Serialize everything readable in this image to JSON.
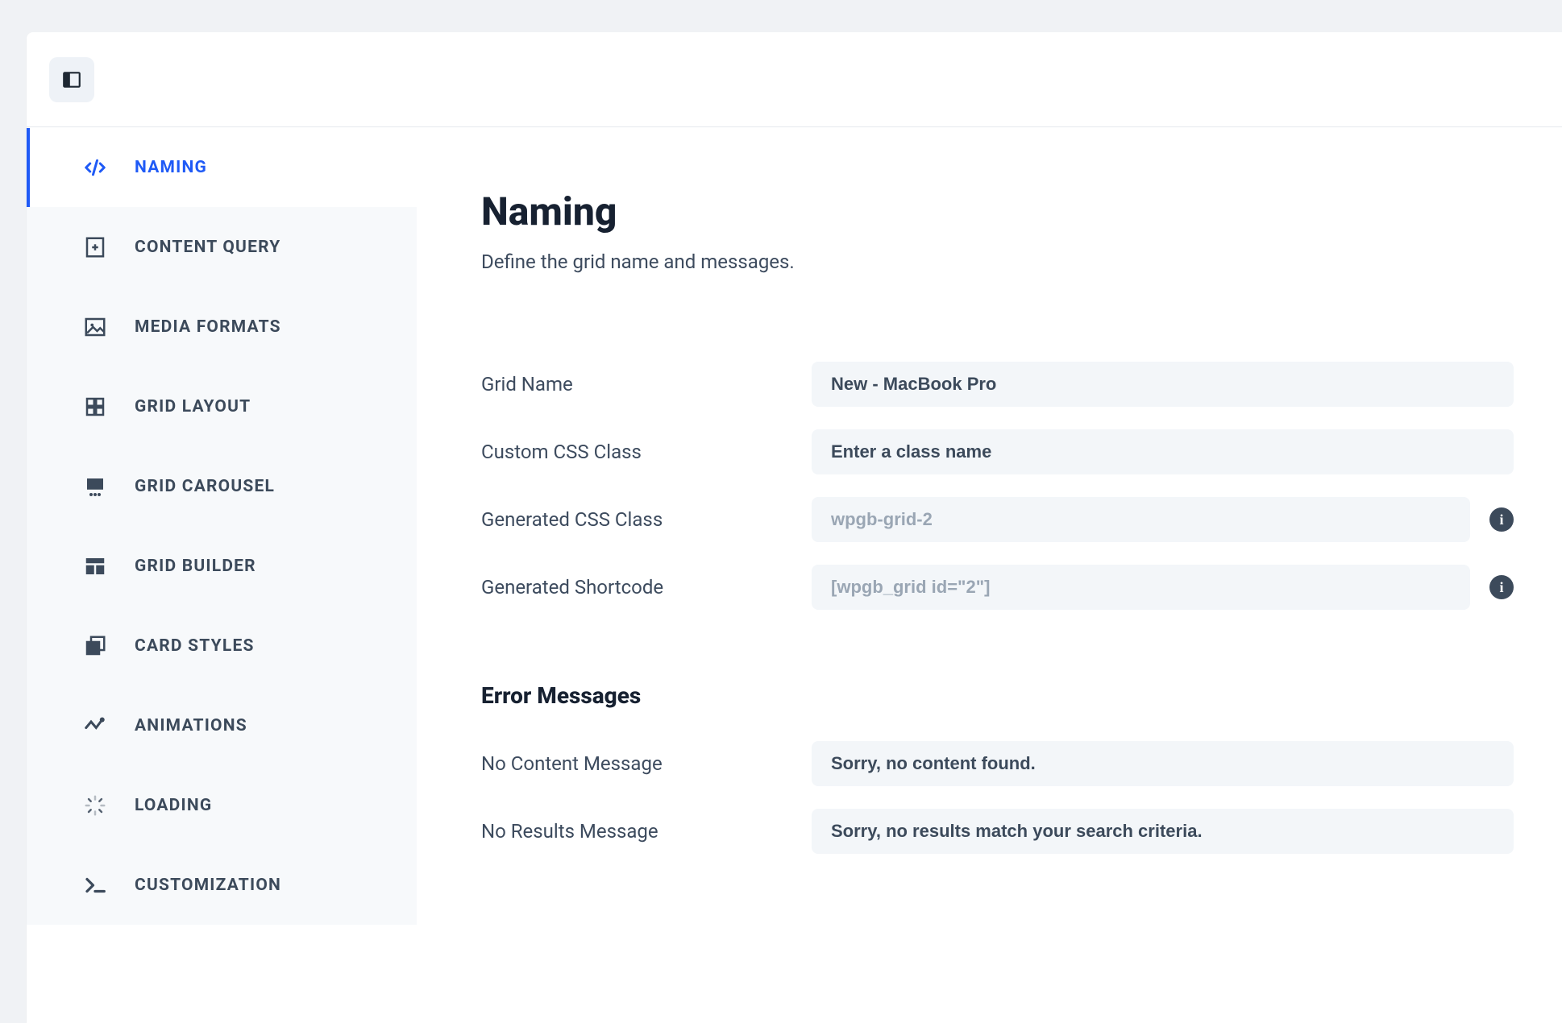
{
  "sidebar": {
    "items": [
      {
        "label": "NAMING",
        "icon": "code-icon",
        "active": true
      },
      {
        "label": "CONTENT QUERY",
        "icon": "add-doc-icon",
        "active": false
      },
      {
        "label": "MEDIA FORMATS",
        "icon": "image-icon",
        "active": false
      },
      {
        "label": "GRID LAYOUT",
        "icon": "grid-icon",
        "active": false
      },
      {
        "label": "GRID CAROUSEL",
        "icon": "carousel-icon",
        "active": false
      },
      {
        "label": "GRID BUILDER",
        "icon": "builder-icon",
        "active": false
      },
      {
        "label": "CARD STYLES",
        "icon": "card-icon",
        "active": false
      },
      {
        "label": "ANIMATIONS",
        "icon": "animation-icon",
        "active": false
      },
      {
        "label": "LOADING",
        "icon": "loading-icon",
        "active": false
      },
      {
        "label": "CUSTOMIZATION",
        "icon": "terminal-icon",
        "active": false
      }
    ]
  },
  "main": {
    "title": "Naming",
    "subtitle": "Define the grid name and messages.",
    "section1": [
      {
        "label": "Grid Name",
        "value": "New - MacBook Pro",
        "placeholder": "",
        "readonly": false,
        "info": false
      },
      {
        "label": "Custom CSS Class",
        "value": "",
        "placeholder": "Enter a class name",
        "readonly": false,
        "info": false
      },
      {
        "label": "Generated CSS Class",
        "value": "wpgb-grid-2",
        "placeholder": "",
        "readonly": true,
        "info": true
      },
      {
        "label": "Generated Shortcode",
        "value": "[wpgb_grid id=\"2\"]",
        "placeholder": "",
        "readonly": true,
        "info": true
      }
    ],
    "section2_title": "Error Messages",
    "section2": [
      {
        "label": "No Content Message",
        "value": "Sorry, no content found.",
        "placeholder": "",
        "readonly": false,
        "info": false
      },
      {
        "label": "No Results Message",
        "value": "Sorry, no results match your search criteria.",
        "placeholder": "",
        "readonly": false,
        "info": false
      }
    ]
  }
}
